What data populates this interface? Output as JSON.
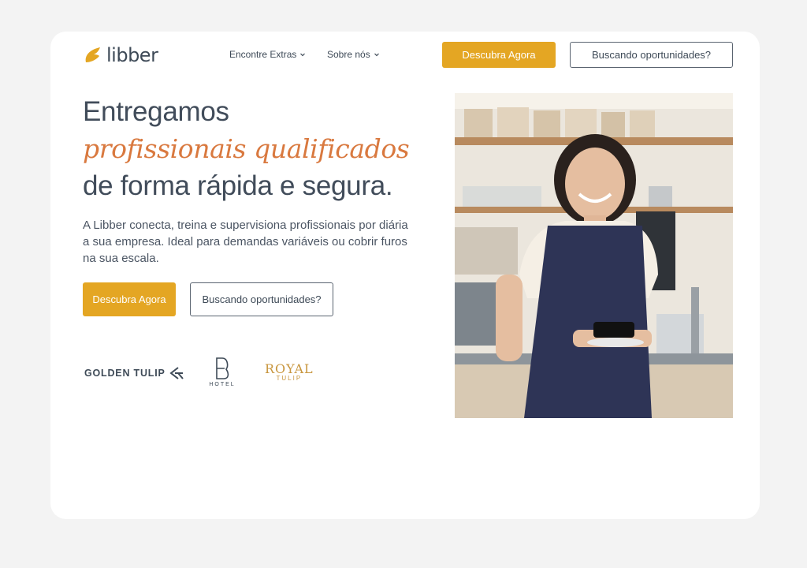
{
  "brand": {
    "name": "libber",
    "color": "#e4a623",
    "logo_icon": "flame-leaf-icon"
  },
  "nav": {
    "items": [
      {
        "label": "Encontre Extras"
      },
      {
        "label": "Sobre nós"
      }
    ]
  },
  "header": {
    "primary_cta": "Descubra Agora",
    "secondary_cta": "Buscando oportunidades?"
  },
  "hero": {
    "headline_line1": "Entregamos",
    "headline_line2": "profissionais qualificados",
    "headline_line3": "de forma rápida e segura.",
    "description": "A Libber conecta, treina e supervisiona profissionais por diária a sua empresa. Ideal para demandas variáveis ou cobrir furos na sua escala.",
    "primary_cta": "Descubra Agora",
    "secondary_cta": "Buscando oportunidades?",
    "accent_color": "#d9793f"
  },
  "partners": {
    "golden_tulip": "GOLDEN TULIP",
    "b_hotel": "HOTEL",
    "royal_tulip_line1": "ROYAL",
    "royal_tulip_line2": "TULIP"
  },
  "colors": {
    "background": "#f3f3f3",
    "card": "#ffffff",
    "text": "#414c5a",
    "primary": "#e4a623"
  }
}
